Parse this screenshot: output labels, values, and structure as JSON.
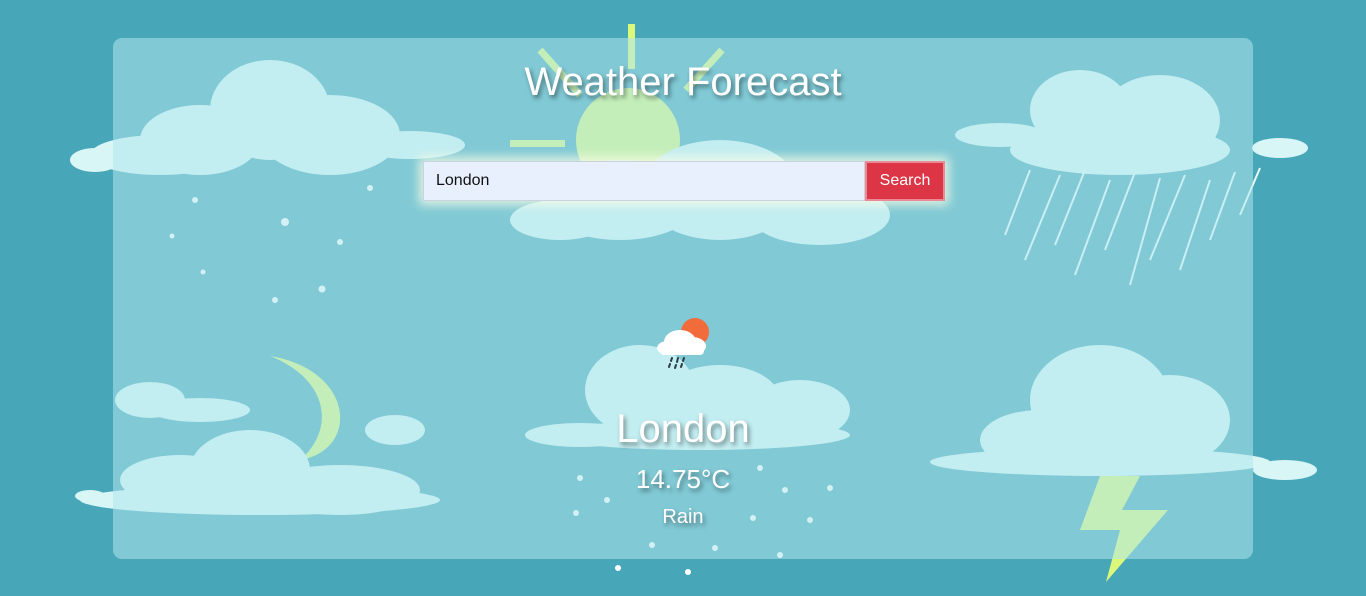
{
  "app": {
    "title": "Weather Forecast"
  },
  "search": {
    "value": "London",
    "button_label": "Search"
  },
  "result": {
    "city": "London",
    "temperature": "14.75°C",
    "description": "Rain",
    "icon": "rain-with-sun-icon"
  },
  "colors": {
    "background": "#47a6b8",
    "panel": "#afe6ec",
    "cloud": "#d9f6f6",
    "sun_moon": "#dcf87a",
    "button": "#dc3545",
    "input": "#e8f0fe"
  }
}
